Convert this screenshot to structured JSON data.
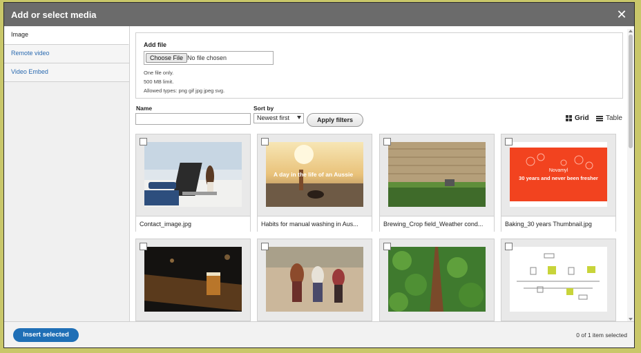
{
  "dialog": {
    "title": "Add or select media",
    "close_glyph": "✕"
  },
  "sidebar": {
    "tabs": [
      {
        "label": "Image",
        "active": true
      },
      {
        "label": "Remote video",
        "active": false
      },
      {
        "label": "Video Embed",
        "active": false
      }
    ]
  },
  "add_file": {
    "label": "Add file",
    "choose_button": "Choose File",
    "no_file": "No file chosen",
    "hint_one": "One file only.",
    "hint_limit": "500 MB limit.",
    "hint_types": "Allowed types: png gif jpg jpeg svg."
  },
  "filters": {
    "name_label": "Name",
    "name_value": "",
    "sort_label": "Sort by",
    "sort_value": "Newest first",
    "apply_button": "Apply filters",
    "grid_label": "Grid",
    "table_label": "Table"
  },
  "media": {
    "items": [
      {
        "caption": "Contact_image.jpg",
        "icon": "laptop-photo"
      },
      {
        "caption": "Habits for manual washing in Aus...",
        "icon": "beach-photo",
        "overlay": "A day in the life of an Aussie"
      },
      {
        "caption": "Brewing_Crop field_Weather cond...",
        "icon": "field-photo"
      },
      {
        "caption": "Baking_30 years Thumbnail.jpg",
        "icon": "balloons-photo",
        "overlay_line1": "Novamyl",
        "overlay_line2": "30 years and never been fresher"
      },
      {
        "caption": "",
        "icon": "beer-photo"
      },
      {
        "caption": "",
        "icon": "farmers-photo"
      },
      {
        "caption": "",
        "icon": "crops-photo"
      },
      {
        "caption": "",
        "icon": "diagram-image"
      }
    ]
  },
  "footer": {
    "insert_button": "Insert selected",
    "status": "0 of 1 item selected"
  },
  "colors": {
    "titlebar": "#6b6b6b",
    "primary_button": "#1f6fb6",
    "link": "#2a6ab0",
    "frame": "#c9c76a"
  }
}
